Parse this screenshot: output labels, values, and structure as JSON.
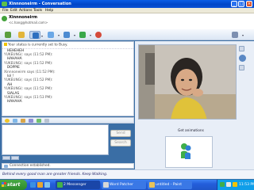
{
  "window": {
    "title": "Xinnnoneirm - Conversation"
  },
  "menu": [
    "File",
    "Edit",
    "Actions",
    "Tools",
    "Help"
  ],
  "header": {
    "contact_name": "Xinnnoneirm",
    "contact_email": "<c.hang@hotmail.com>"
  },
  "toolbar": {
    "buttons": [
      "invite-icon",
      "send-files-icon",
      "webcam-icon",
      "call-icon",
      "activities-icon",
      "games-icon",
      "block-icon",
      "change-background-icon"
    ]
  },
  "conversation": {
    "status_line": "Your status is currently set to Busy.",
    "messages": [
      {
        "from": "",
        "text": "HEHEHEH"
      },
      {
        "from": "YUKEUNG(: says (11:52 PM):",
        "text": "HAHAHA"
      },
      {
        "from": "YUKEUNG(: says (11:52 PM):",
        "text": "DOPPIE"
      },
      {
        "from": "Xinnnoneirm says (11:52 PM):",
        "text": "lol !"
      },
      {
        "from": "YUKEUNG(: says (11:52 PM):",
        "text": "AH"
      },
      {
        "from": "YUKEUNG(: says (11:52 PM):",
        "text": "SIALAS"
      },
      {
        "from": "YUKEUNG(: says (11:53 PM):",
        "text": "HAHAHA"
      }
    ]
  },
  "compose": {
    "send_label": "Send",
    "search_label": "Search"
  },
  "status_bar": {
    "text": "Connection established."
  },
  "right_pane": {
    "webcam_link": "Get animations"
  },
  "ad": {
    "text": "Behind every good man are greater friends. Keep Walking."
  },
  "taskbar": {
    "start_label": "start",
    "tasks": [
      {
        "label": "2 Messenger",
        "active": true
      },
      {
        "label": "Word Patcher",
        "active": false
      },
      {
        "label": "untitled - Paint",
        "active": false
      }
    ],
    "clock": "11:53 PM"
  }
}
